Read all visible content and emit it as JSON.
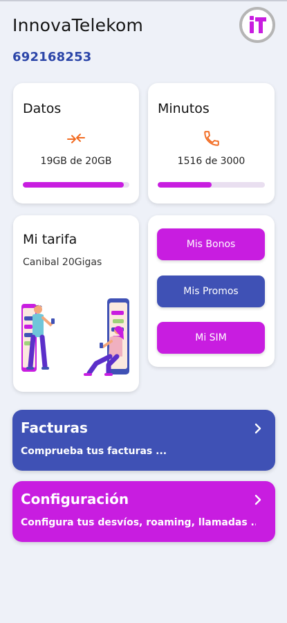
{
  "app": {
    "title": "InnovaTelekom",
    "logo_icon": "innova-logo-icon",
    "phone_number": "692168253"
  },
  "usage": {
    "data": {
      "title": "Datos",
      "icon": "data-transfer-arrows-icon",
      "text": "19GB de 20GB",
      "fraction": 0.95
    },
    "minutes": {
      "title": "Minutos",
      "icon": "phone-icon",
      "text": "1516 de 3000",
      "fraction": 0.505
    }
  },
  "tariff": {
    "title": "Mi tarifa",
    "name": "Canibal 20Gigas"
  },
  "actions": {
    "bonos": "Mis Bonos",
    "promos": "Mis Promos",
    "sim": "Mi SIM"
  },
  "banners": {
    "facturas": {
      "title": "Facturas",
      "subtitle": "Comprueba tus facturas ..."
    },
    "configuracion": {
      "title": "Configuración",
      "subtitle": "Configura tus desvíos, roaming, llamadas ..."
    }
  },
  "colors": {
    "magenta": "#c81de0",
    "blue": "#3f51b5",
    "phone_blue": "#2b45a8",
    "icon_orange": "#f26b21",
    "background": "#eef1f8"
  }
}
